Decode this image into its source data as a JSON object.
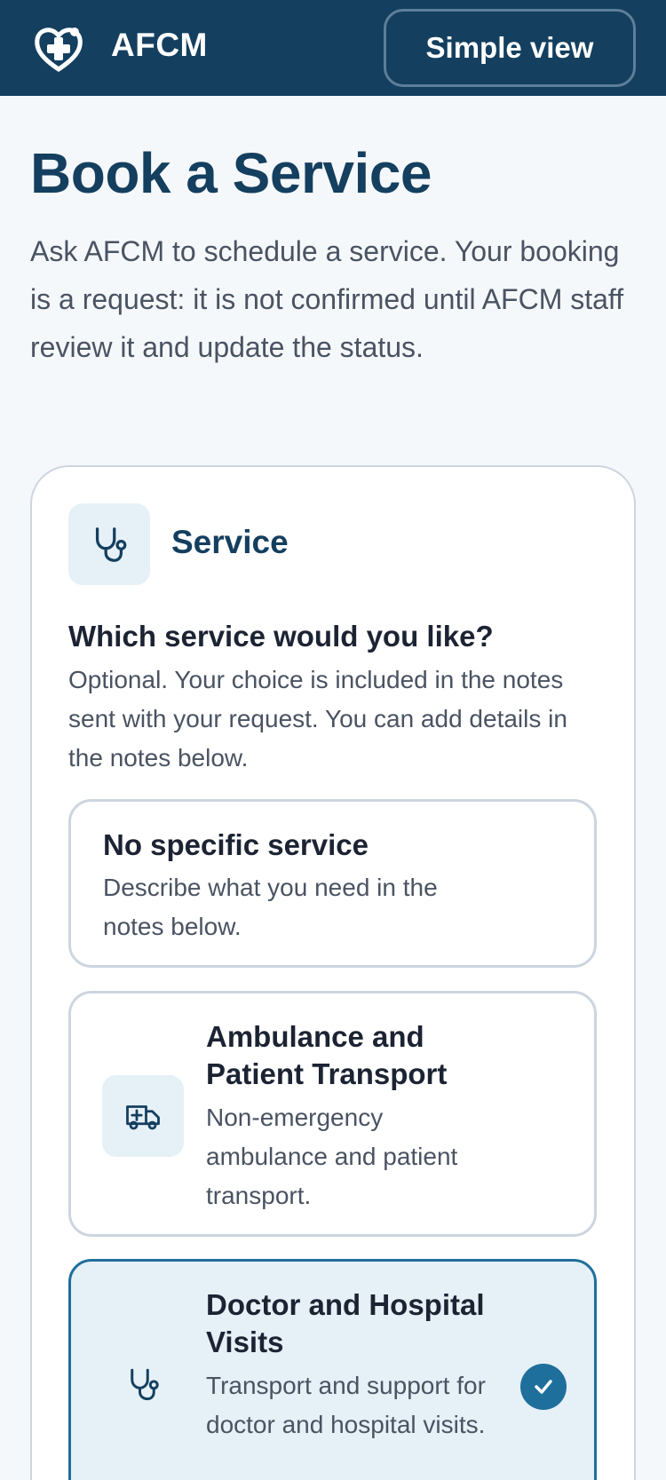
{
  "header": {
    "brand": "AFCM",
    "simple_view_label": "Simple view"
  },
  "page": {
    "title": "Book a Service",
    "intro": "Ask AFCM to schedule a service. Your booking is a request: it is not confirmed until AFCM staff review it and update the status."
  },
  "service_section": {
    "title": "Service",
    "icon": "stethoscope-icon",
    "question": "Which service would you like?",
    "help": "Optional. Your choice is included in the notes sent with your request. You can add details in the notes below.",
    "options": [
      {
        "title": "No specific service",
        "description": "Describe what you need in the notes below.",
        "icon": "",
        "selected": false
      },
      {
        "title": "Ambulance and Patient Transport",
        "description": "Non-emergency ambulance and patient transport.",
        "icon": "ambulance-icon",
        "selected": false
      },
      {
        "title": "Doctor and Hospital Visits",
        "description": "Transport and support for doctor and hospital visits.",
        "icon": "stethoscope-icon",
        "selected": true
      }
    ]
  },
  "colors": {
    "header_bg": "#143f5f",
    "accent": "#1f6f9c",
    "selected_bg": "#e6f0f7",
    "border": "#cdd5e0"
  }
}
